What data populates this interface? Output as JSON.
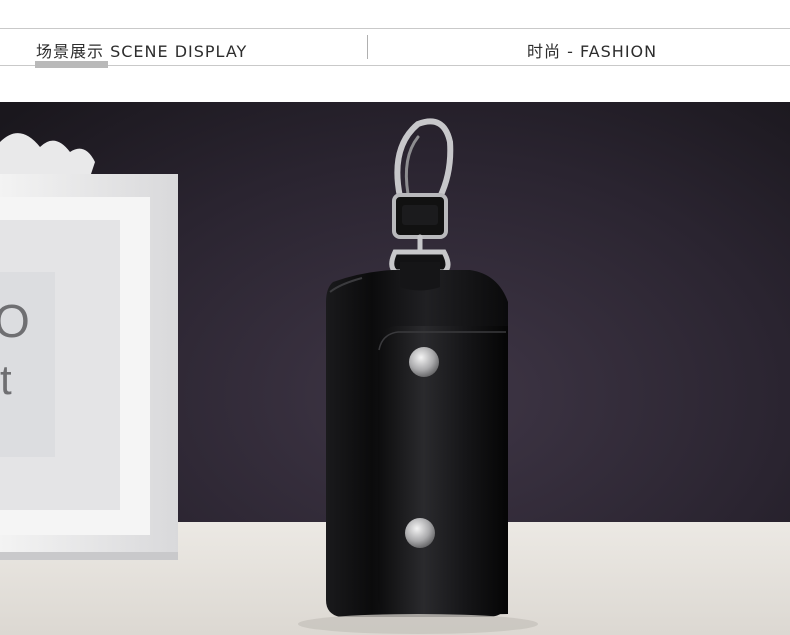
{
  "header": {
    "left_title": "场景展示 SCENE DISPLAY",
    "right_title": "时尚 - FASHION"
  },
  "photo": {
    "frame_text_1": "O",
    "frame_text_2": "t",
    "colors": {
      "background_top": "#231f26",
      "background_mid": "#3d3444",
      "table_surface": "#e6e3de",
      "leather": "#0f0f10",
      "metal": "#c9c9cc"
    }
  }
}
